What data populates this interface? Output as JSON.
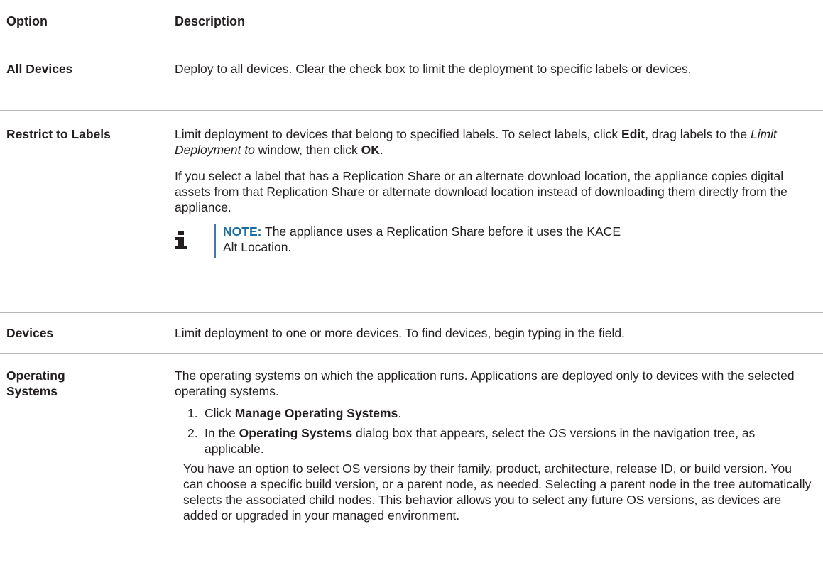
{
  "table": {
    "header": {
      "option": "Option",
      "description": "Description"
    },
    "rows": [
      {
        "option": "All Devices",
        "desc": "Deploy to all devices. Clear the check box to limit the deployment to specific labels or devices."
      },
      {
        "option": "Restrict to Labels",
        "desc_a": "Limit deployment to devices that belong to specified labels. To select labels, click ",
        "desc_b": "Edit",
        "desc_c": ", drag labels to the ",
        "desc_d": "Limit Deployment to",
        "desc_e": " window, then click ",
        "desc_f": "OK",
        "desc_g": ".",
        "para2": "If you select a label that has a Replication Share or an alternate download location, the appliance copies digital assets from that Replication Share or alternate download location instead of downloading them directly from the appliance.",
        "note_label": "NOTE:",
        "note_text": " The appliance uses a Replication Share before it uses the KACE Alt Location."
      },
      {
        "option": "Devices",
        "desc": "Limit deployment to one or more devices. To find devices, begin typing in the field."
      },
      {
        "option_line1": "Operating",
        "option_line2": "Systems",
        "desc": "The operating systems on which the application runs. Applications are deployed only to devices with the selected operating systems.",
        "steps": [
          {
            "num": "1.",
            "a": "Click ",
            "b": "Manage Operating Systems",
            "c": "."
          },
          {
            "num": "2.",
            "a": "In the ",
            "b": "Operating Systems",
            "c": " dialog box that appears, select the OS versions in the navigation tree, as applicable."
          }
        ],
        "after_steps": "You have an option to select OS versions by their family, product, architecture, release ID, or build version. You can choose a specific build version, or a parent node, as needed. Selecting a parent node in the tree automatically selects the associated child nodes. This behavior allows you to select any future OS versions, as devices are added or upgraded in your managed environment."
      }
    ]
  },
  "icons": {
    "note": "info-icon"
  },
  "colors": {
    "note_label": "#1a6ea0",
    "note_bar": "#3f7aa9",
    "text": "#231f20"
  }
}
